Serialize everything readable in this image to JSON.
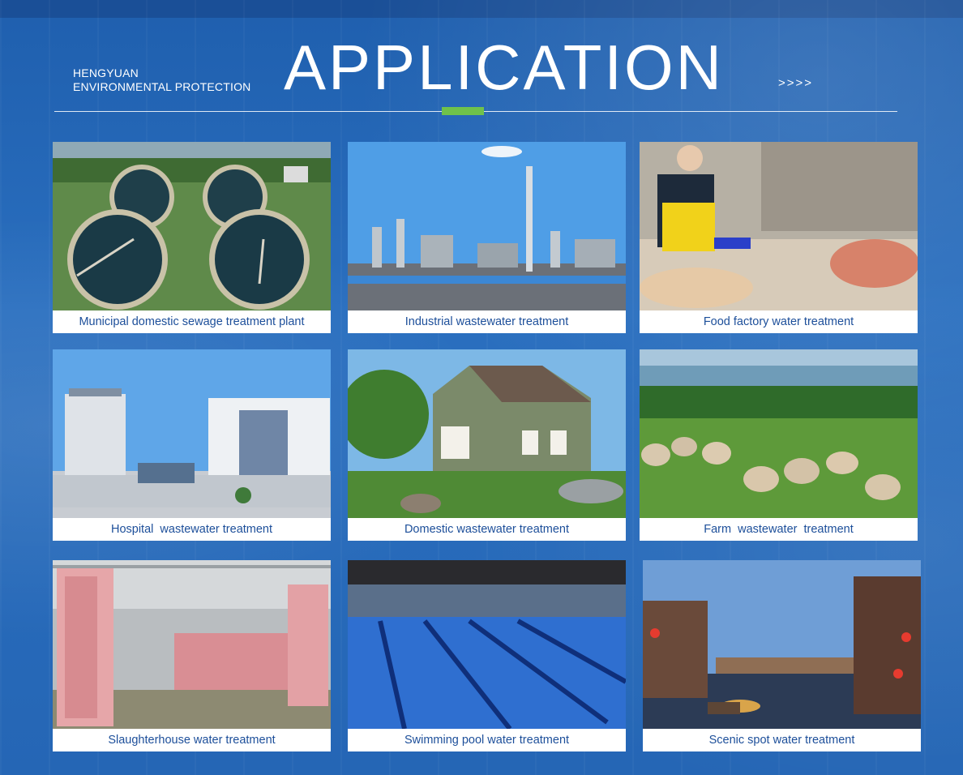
{
  "header": {
    "brand_line1": "HENGYUAN",
    "brand_line2": "ENVIRONMENTAL PROTECTION",
    "title": "APPLICATION",
    "arrows": ">>>>"
  },
  "colors": {
    "background": "#2566b5",
    "accent": "#6fc24b",
    "caption_text": "#1d4f9a"
  },
  "cards": [
    {
      "caption": "Municipal domestic sewage treatment plant"
    },
    {
      "caption": "Industrial wastewater treatment"
    },
    {
      "caption": "Food factory water treatment"
    },
    {
      "caption": "Hospital  wastewater treatment"
    },
    {
      "caption": "Domestic wastewater treatment"
    },
    {
      "caption": "Farm  wastewater  treatment"
    },
    {
      "caption": "Slaughterhouse water treatment"
    },
    {
      "caption": "Swimming pool water treatment"
    },
    {
      "caption": "Scenic spot water treatment"
    }
  ]
}
